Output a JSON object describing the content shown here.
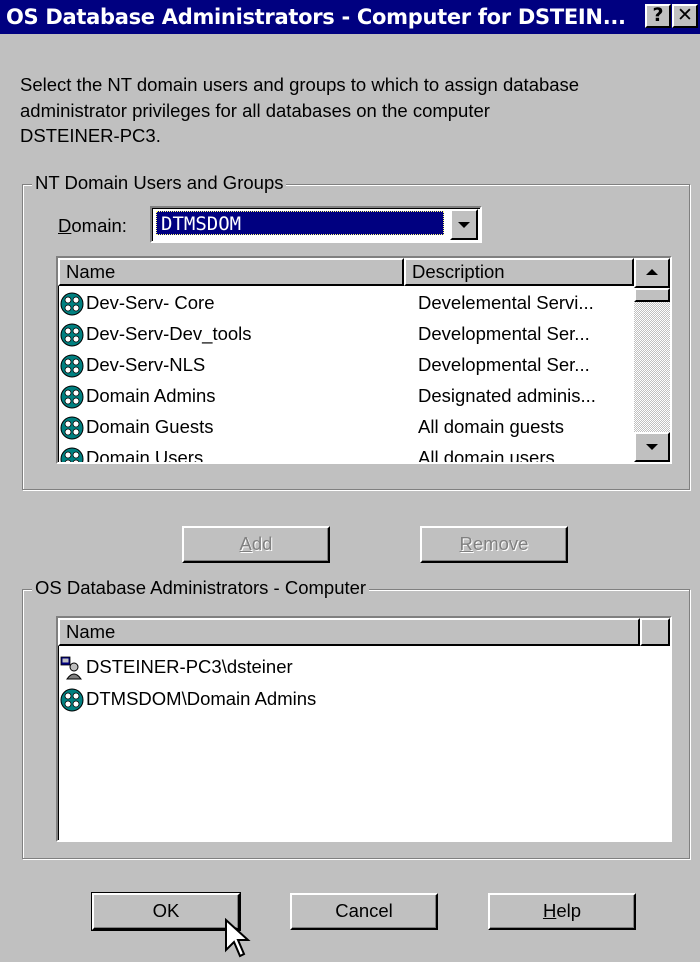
{
  "window": {
    "title": "OS Database Administrators - Computer for DSTEIN...",
    "help_glyph": "?",
    "close_glyph": "✕"
  },
  "instructions": {
    "line1": "Select the NT domain users and groups to which to assign database",
    "line2": "administrator privileges for all databases on the computer",
    "line3": "DSTEINER-PC3."
  },
  "domain_group": {
    "legend": "NT Domain Users and Groups",
    "domain_label_mnemonic": "D",
    "domain_label_rest": "omain:",
    "domain_value": "DTMSDOM",
    "columns": {
      "name": "Name",
      "description": "Description"
    },
    "rows": [
      {
        "name": "Dev-Serv- Core",
        "description": "Develemental Servi..."
      },
      {
        "name": "Dev-Serv-Dev_tools",
        "description": "Developmental Ser..."
      },
      {
        "name": "Dev-Serv-NLS",
        "description": "Developmental Ser..."
      },
      {
        "name": "Domain Admins",
        "description": "Designated adminis..."
      },
      {
        "name": "Domain Guests",
        "description": "All domain guests"
      },
      {
        "name": "Domain Users",
        "description": "All domain users"
      }
    ]
  },
  "actions": {
    "add_mnemonic": "A",
    "add_rest": "dd",
    "remove_mnemonic": "R",
    "remove_rest": "emove"
  },
  "admins_group": {
    "legend": "OS Database Administrators - Computer",
    "columns": {
      "name": "Name"
    },
    "rows": [
      {
        "name": "DSTEINER-PC3\\dsteiner",
        "icon": "user-icon"
      },
      {
        "name": "DTMSDOM\\Domain Admins",
        "icon": "group-icon"
      }
    ]
  },
  "footer": {
    "ok_label": "OK",
    "cancel_label": "Cancel",
    "help_mnemonic": "H",
    "help_rest": "elp"
  }
}
